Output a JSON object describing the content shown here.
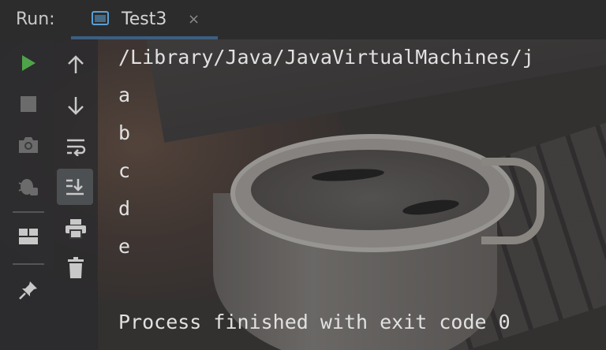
{
  "header": {
    "run_label": "Run:",
    "tab_title": "Test3",
    "tab_close_glyph": "×"
  },
  "toolbar_left": [
    {
      "name": "run-icon",
      "color": "#4ea34a"
    },
    {
      "name": "stop-icon"
    },
    {
      "name": "camera-icon"
    },
    {
      "name": "debug-icon"
    },
    {
      "name": "layout-icon"
    },
    {
      "name": "pin-icon"
    }
  ],
  "toolbar_right": [
    {
      "name": "arrow-up-icon"
    },
    {
      "name": "arrow-down-icon"
    },
    {
      "name": "soft-wrap-icon"
    },
    {
      "name": "scroll-to-end-icon",
      "active": true
    },
    {
      "name": "print-icon"
    },
    {
      "name": "trash-icon"
    }
  ],
  "console": {
    "lines": [
      "/Library/Java/JavaVirtualMachines/j",
      "a",
      "b",
      "c",
      "d",
      "e",
      "",
      "Process finished with exit code 0"
    ]
  },
  "colors": {
    "accent": "#4a88c7",
    "run_green": "#4ea34a",
    "text": "#e1e1e1"
  }
}
